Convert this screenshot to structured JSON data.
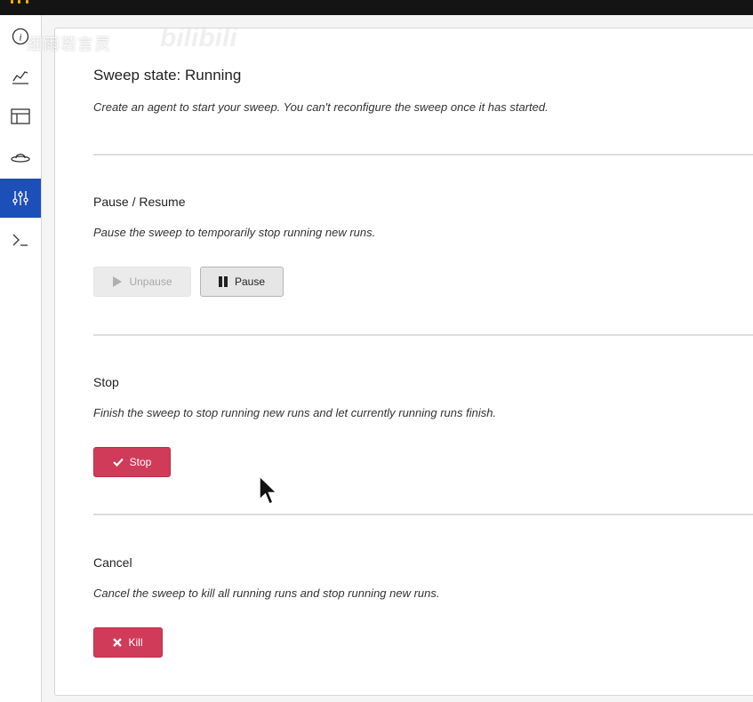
{
  "sidebar": {
    "items": [
      {
        "icon": "info-icon"
      },
      {
        "icon": "chart-line-icon"
      },
      {
        "icon": "table-icon"
      },
      {
        "icon": "artifacts-hat-icon"
      },
      {
        "icon": "sweep-sliders-icon",
        "active": true
      },
      {
        "icon": "terminal-icon"
      }
    ],
    "active_color": "#1d4fb8"
  },
  "header": {
    "title": "Sweep state: Running",
    "subtitle": "Create an agent to start your sweep. You can't reconfigure the sweep once it has started."
  },
  "pause_section": {
    "title": "Pause / Resume",
    "description": "Pause the sweep to temporarily stop running new runs.",
    "unpause_label": "Unpause",
    "pause_label": "Pause"
  },
  "stop_section": {
    "title": "Stop",
    "description": "Finish the sweep to stop running new runs and let currently running runs finish.",
    "stop_label": "Stop"
  },
  "cancel_section": {
    "title": "Cancel",
    "description": "Cancel the sweep to kill all running runs and stop running new runs.",
    "kill_label": "Kill"
  },
  "watermark": {
    "text": "细雨若言灵",
    "logo": "bilibili"
  },
  "colors": {
    "danger": "#cf3b59",
    "accent": "#1d4fb8"
  }
}
